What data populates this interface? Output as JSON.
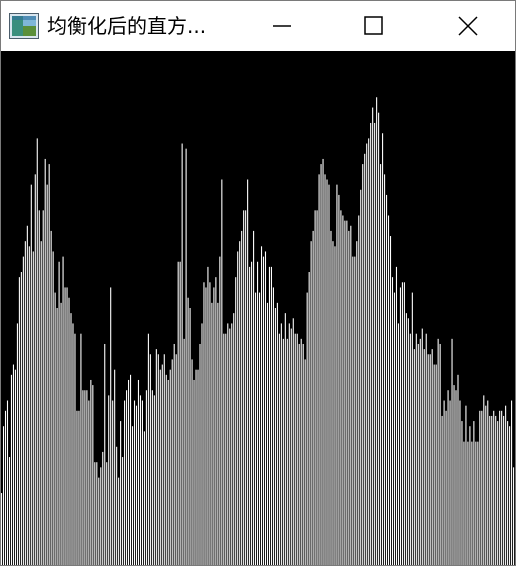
{
  "window": {
    "title": "均衡化后的直方...",
    "controls": {
      "minimize": "minimize-icon",
      "maximize": "maximize-icon",
      "close": "close-icon"
    }
  },
  "colors": {
    "background": "#000000",
    "bars": "#ffffff",
    "titlebar": "#ffffff"
  },
  "chart_data": {
    "type": "bar",
    "title": "",
    "xlabel": "",
    "ylabel": "",
    "grid": false,
    "ylim": [
      0,
      1
    ],
    "x": [
      0,
      1,
      2,
      3,
      4,
      5,
      6,
      7,
      8,
      9,
      10,
      11,
      12,
      13,
      14,
      15,
      16,
      17,
      18,
      19,
      20,
      21,
      22,
      23,
      24,
      25,
      26,
      27,
      28,
      29,
      30,
      31,
      32,
      33,
      34,
      35,
      36,
      37,
      38,
      39,
      40,
      41,
      42,
      43,
      44,
      45,
      46,
      47,
      48,
      49,
      50,
      51,
      52,
      53,
      54,
      55,
      56,
      57,
      58,
      59,
      60,
      61,
      62,
      63,
      64,
      65,
      66,
      67,
      68,
      69,
      70,
      71,
      72,
      73,
      74,
      75,
      76,
      77,
      78,
      79,
      80,
      81,
      82,
      83,
      84,
      85,
      86,
      87,
      88,
      89,
      90,
      91,
      92,
      93,
      94,
      95,
      96,
      97,
      98,
      99,
      100,
      101,
      102,
      103,
      104,
      105,
      106,
      107,
      108,
      109,
      110,
      111,
      112,
      113,
      114,
      115,
      116,
      117,
      118,
      119,
      120,
      121,
      122,
      123,
      124,
      125,
      126,
      127,
      128,
      129,
      130,
      131,
      132,
      133,
      134,
      135,
      136,
      137,
      138,
      139,
      140,
      141,
      142,
      143,
      144,
      145,
      146,
      147,
      148,
      149,
      150,
      151,
      152,
      153,
      154,
      155,
      156,
      157,
      158,
      159,
      160,
      161,
      162,
      163,
      164,
      165,
      166,
      167,
      168,
      169,
      170,
      171,
      172,
      173,
      174,
      175,
      176,
      177,
      178,
      179,
      180,
      181,
      182,
      183,
      184,
      185,
      186,
      187,
      188,
      189,
      190,
      191,
      192,
      193,
      194,
      195,
      196,
      197,
      198,
      199,
      200,
      201,
      202,
      203,
      204,
      205,
      206,
      207,
      208,
      209,
      210,
      211,
      212,
      213,
      214,
      215,
      216,
      217,
      218,
      219,
      220,
      221,
      222,
      223,
      224,
      225,
      226,
      227,
      228,
      229,
      230,
      231,
      232,
      233,
      234,
      235,
      236,
      237,
      238,
      239,
      240,
      241,
      242,
      243,
      244,
      245,
      246,
      247,
      248,
      249,
      250,
      251,
      252,
      253,
      254,
      255
    ],
    "values": [
      0.14,
      0.27,
      0.3,
      0.32,
      0.21,
      0.37,
      0.39,
      0.38,
      0.47,
      0.56,
      0.57,
      0.6,
      0.63,
      0.66,
      0.62,
      0.74,
      0.61,
      0.76,
      0.83,
      0.69,
      0.63,
      0.69,
      0.79,
      0.74,
      0.78,
      0.65,
      0.61,
      0.53,
      0.5,
      0.59,
      0.51,
      0.6,
      0.54,
      0.54,
      0.52,
      0.49,
      0.47,
      0.45,
      0.3,
      0.3,
      0.45,
      0.34,
      0.34,
      0.34,
      0.32,
      0.36,
      0.35,
      0.2,
      0.2,
      0.17,
      0.19,
      0.22,
      0.43,
      0.2,
      0.33,
      0.54,
      0.32,
      0.38,
      0.23,
      0.17,
      0.28,
      0.21,
      0.32,
      0.34,
      0.36,
      0.37,
      0.27,
      0.32,
      0.31,
      0.36,
      0.33,
      0.32,
      0.26,
      0.34,
      0.45,
      0.41,
      0.34,
      0.33,
      0.42,
      0.41,
      0.38,
      0.39,
      0.41,
      0.37,
      0.36,
      0.38,
      0.4,
      0.43,
      0.41,
      0.59,
      0.59,
      0.82,
      0.44,
      0.81,
      0.52,
      0.5,
      0.4,
      0.36,
      0.38,
      0.38,
      0.43,
      0.47,
      0.55,
      0.54,
      0.58,
      0.55,
      0.51,
      0.54,
      0.56,
      0.51,
      0.6,
      0.75,
      0.45,
      0.45,
      0.47,
      0.46,
      0.47,
      0.49,
      0.56,
      0.61,
      0.63,
      0.65,
      0.69,
      0.69,
      0.75,
      0.58,
      0.59,
      0.65,
      0.53,
      0.59,
      0.53,
      0.62,
      0.6,
      0.61,
      0.51,
      0.58,
      0.58,
      0.54,
      0.5,
      0.51,
      0.45,
      0.47,
      0.44,
      0.49,
      0.44,
      0.47,
      0.46,
      0.48,
      0.45,
      0.45,
      0.43,
      0.44,
      0.43,
      0.4,
      0.53,
      0.57,
      0.63,
      0.65,
      0.69,
      0.69,
      0.76,
      0.78,
      0.79,
      0.76,
      0.75,
      0.74,
      0.65,
      0.63,
      0.62,
      0.74,
      0.72,
      0.69,
      0.68,
      0.67,
      0.67,
      0.65,
      0.66,
      0.6,
      0.6,
      0.63,
      0.68,
      0.73,
      0.78,
      0.8,
      0.82,
      0.83,
      0.86,
      0.89,
      0.86,
      0.91,
      0.88,
      0.78,
      0.84,
      0.76,
      0.72,
      0.68,
      0.64,
      0.56,
      0.53,
      0.58,
      0.47,
      0.54,
      0.55,
      0.55,
      0.49,
      0.48,
      0.45,
      0.53,
      0.42,
      0.45,
      0.43,
      0.44,
      0.46,
      0.42,
      0.45,
      0.41,
      0.41,
      0.42,
      0.39,
      0.39,
      0.44,
      0.43,
      0.29,
      0.32,
      0.3,
      0.34,
      0.32,
      0.44,
      0.35,
      0.34,
      0.37,
      0.32,
      0.28,
      0.24,
      0.31,
      0.24,
      0.27,
      0.24,
      0.28,
      0.24,
      0.24,
      0.3,
      0.3,
      0.33,
      0.31,
      0.32,
      0.29,
      0.29,
      0.3,
      0.29,
      0.28,
      0.3,
      0.3,
      0.29,
      0.31,
      0.28,
      0.27,
      0.32,
      0.19
    ]
  }
}
